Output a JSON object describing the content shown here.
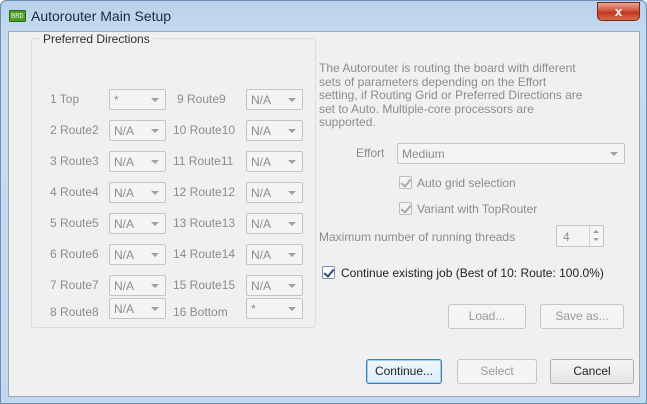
{
  "window": {
    "title": "Autorouter Main Setup",
    "icon_text": "BRD",
    "close_label": "x"
  },
  "directions": {
    "title": "Preferred Directions",
    "left": [
      {
        "label": "1 Top",
        "value": "*"
      },
      {
        "label": "2 Route2",
        "value": "N/A"
      },
      {
        "label": "3 Route3",
        "value": "N/A"
      },
      {
        "label": "4 Route4",
        "value": "N/A"
      },
      {
        "label": "5 Route5",
        "value": "N/A"
      },
      {
        "label": "6 Route6",
        "value": "N/A"
      },
      {
        "label": "7 Route7",
        "value": "N/A"
      },
      {
        "label": "8 Route8",
        "value": "N/A"
      }
    ],
    "right": [
      {
        "label": "9 Route9",
        "value": "N/A"
      },
      {
        "label": "10 Route10",
        "value": "N/A"
      },
      {
        "label": "11 Route11",
        "value": "N/A"
      },
      {
        "label": "12 Route12",
        "value": "N/A"
      },
      {
        "label": "13 Route13",
        "value": "N/A"
      },
      {
        "label": "14 Route14",
        "value": "N/A"
      },
      {
        "label": "15 Route15",
        "value": "N/A"
      },
      {
        "label": "16 Bottom",
        "value": "*"
      }
    ]
  },
  "description": {
    "lines": [
      "The Autorouter is routing the board with different",
      "sets of parameters depending on the Effort",
      "setting, if Routing Grid or Preferred Directions are",
      "set to Auto. Multiple-core processors are",
      "supported."
    ]
  },
  "effort": {
    "label": "Effort",
    "value": "Medium"
  },
  "auto_grid": {
    "label": "Auto grid selection",
    "checked": true
  },
  "variant": {
    "label": "Variant with TopRouter",
    "checked": true
  },
  "threads": {
    "label": "Maximum number of running threads",
    "value": "4"
  },
  "continue_job": {
    "label": "Continue existing job (Best of 10: Route: 100.0%)",
    "checked": true
  },
  "buttons": {
    "load": "Load...",
    "save_as": "Save as...",
    "continue": "Continue...",
    "select": "Select",
    "cancel": "Cancel"
  },
  "colors": {
    "title_bar": "#b9d1ea",
    "close": "#c23a20",
    "dialog_bg": "#f0f0f0",
    "disabled_text": "#8c8c8c"
  }
}
